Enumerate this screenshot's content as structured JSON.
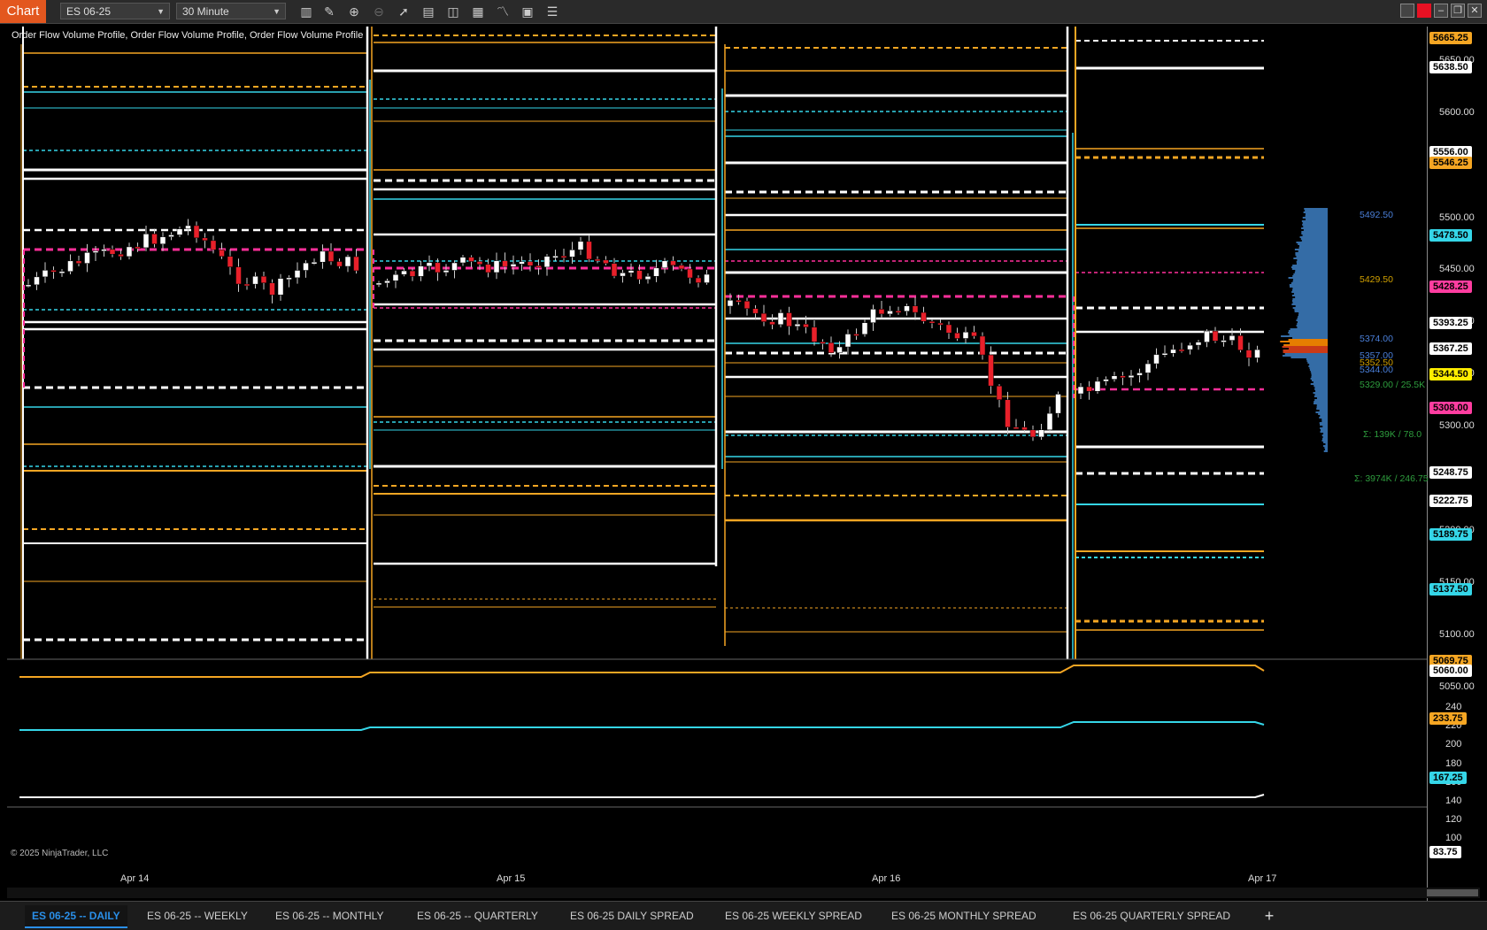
{
  "toolbar": {
    "app_badge": "Chart",
    "instrument": "ES 06-25",
    "interval": "30 Minute",
    "icons": [
      "bar-style-icon",
      "draw-pencil-icon",
      "zoom-in-icon",
      "zoom-out-icon",
      "pointer-icon",
      "data-box-icon",
      "properties-icon",
      "templates-icon",
      "indicators-icon",
      "strategies-icon",
      "list-icon"
    ]
  },
  "chart": {
    "indicator_label": "Order Flow Volume Profile, Order Flow Volume Profile, Order Flow Volume Profile",
    "copyright": "© 2025 NinjaTrader, LLC",
    "date_labels": [
      "Apr 14",
      "Apr 15",
      "Apr 16",
      "Apr 17"
    ]
  },
  "price_axis": {
    "ticks": [
      "5650.00",
      "5600.00",
      "5500.00",
      "5450.00",
      "5400.00",
      "5350.00",
      "5300.00",
      "5200.00",
      "5150.00",
      "5100.00",
      "5050.00"
    ],
    "tags": [
      {
        "text": "5665.25",
        "color": "#f5a623"
      },
      {
        "text": "5638.50",
        "color": "#ffffff"
      },
      {
        "text": "5556.00",
        "color": "#ffffff"
      },
      {
        "text": "5546.25",
        "color": "#f5a623"
      },
      {
        "text": "5478.50",
        "color": "#35d6e8"
      },
      {
        "text": "5428.25",
        "color": "#ff3da0"
      },
      {
        "text": "5393.25",
        "color": "#ffffff"
      },
      {
        "text": "5367.25",
        "color": "#ffffff"
      },
      {
        "text": "5344.50",
        "color": "#ffee00"
      },
      {
        "text": "5308.00",
        "color": "#ff3da0"
      },
      {
        "text": "5248.75",
        "color": "#ffffff"
      },
      {
        "text": "5222.75",
        "color": "#ffffff"
      },
      {
        "text": "5189.75",
        "color": "#35d6e8"
      },
      {
        "text": "5137.50",
        "color": "#35d6e8"
      },
      {
        "text": "5069.75",
        "color": "#f5a623"
      },
      {
        "text": "5060.00",
        "color": "#ffffff"
      }
    ],
    "vp_labels": [
      {
        "text": "5492.50",
        "color": "#4a7fd8"
      },
      {
        "text": "5429.50",
        "color": "#d0a000"
      },
      {
        "text": "5374.00",
        "color": "#4a7fd8"
      },
      {
        "text": "5357.00",
        "color": "#4a7fd8"
      },
      {
        "text": "5352.50",
        "color": "#d0a000"
      },
      {
        "text": "5344.00",
        "color": "#4a7fd8"
      },
      {
        "text": "5329.00 / 25.5K",
        "color": "#2e9e3e"
      },
      {
        "text": "Σ: 139K / 78.0",
        "color": "#2e9e3e"
      },
      {
        "text": "Σ: 3974K / 246.75",
        "color": "#2e9e3e"
      }
    ]
  },
  "indicator_axis": {
    "ticks": [
      "240",
      "220",
      "200",
      "180",
      "160",
      "140",
      "120",
      "100"
    ],
    "tags": [
      {
        "text": "233.75",
        "color": "#f5a623"
      },
      {
        "text": "167.25",
        "color": "#35d6e8"
      },
      {
        "text": "83.75",
        "color": "#ffffff"
      }
    ]
  },
  "tabs": [
    "ES 06-25 -- DAILY",
    "ES 06-25 -- WEEKLY",
    "ES 06-25 -- MONTHLY",
    "ES 06-25 -- QUARTERLY",
    "ES 06-25 DAILY SPREAD",
    "ES 06-25 WEEKLY SPREAD",
    "ES 06-25 MONTHLY SPREAD",
    "ES 06-25 QUARTERLY SPREAD"
  ],
  "colors": {
    "white": "#ffffff",
    "orange": "#f5a623",
    "cyan": "#35d6e8",
    "magenta": "#ff2f9a",
    "up": "#ffffff",
    "down": "#e8202a",
    "background": "#000000"
  }
}
